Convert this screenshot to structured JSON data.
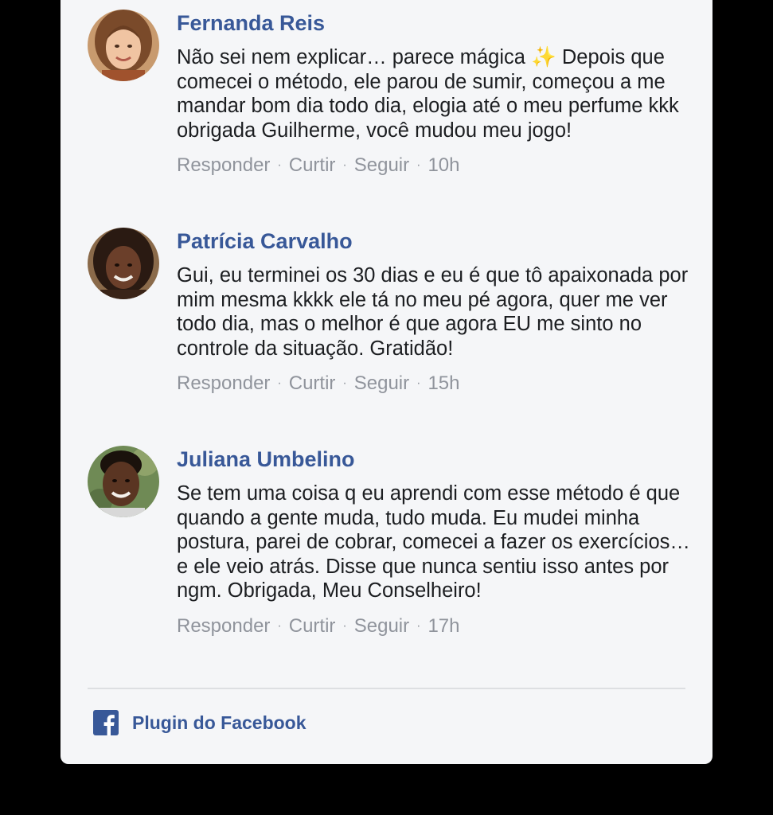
{
  "comments": [
    {
      "author": "Fernanda Reis",
      "text": "Não sei nem explicar… parece mágica ✨ Depois que comecei o método, ele parou de sumir, começou a me mandar bom dia todo dia, elogia até o meu perfume kkk obrigada Guilherme, você mudou meu jogo!",
      "actions": {
        "reply": "Responder",
        "like": "Curtir",
        "follow": "Seguir"
      },
      "time": "10h"
    },
    {
      "author": "Patrícia Carvalho",
      "text": "Gui, eu terminei os 30 dias e eu é que tô apaixonada por mim mesma kkkk ele tá no meu pé agora, quer me ver todo dia, mas o melhor é que agora EU me sinto no controle da situação. Gratidão!",
      "actions": {
        "reply": "Responder",
        "like": "Curtir",
        "follow": "Seguir"
      },
      "time": "15h"
    },
    {
      "author": "Juliana Umbelino",
      "text": "Se tem uma coisa q eu aprendi com esse método é que quando a gente muda, tudo muda. Eu mudei minha postura, parei de cobrar, comecei a fazer os exercícios… e ele veio atrás. Disse que nunca sentiu isso antes por ngm. Obrigada, Meu Conselheiro!",
      "actions": {
        "reply": "Responder",
        "like": "Curtir",
        "follow": "Seguir"
      },
      "time": "17h"
    }
  ],
  "footer": {
    "label": "Plugin do Facebook",
    "icon": "facebook-icon"
  },
  "colors": {
    "author_link": "#385898",
    "card_bg": "#f5f6f8",
    "meta_gray": "#90949c",
    "text": "#1c1e21"
  }
}
